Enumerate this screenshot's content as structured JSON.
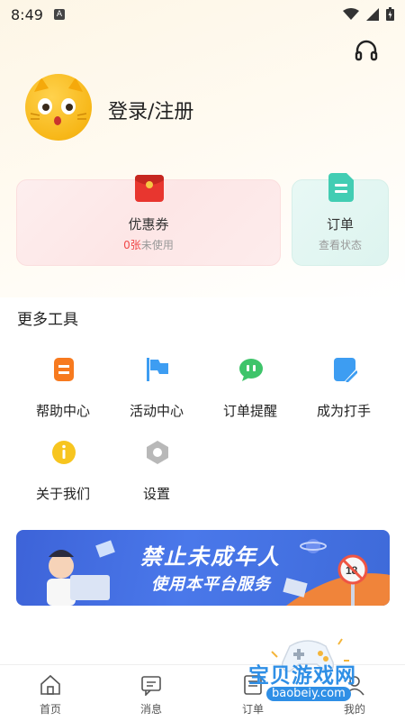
{
  "status": {
    "time": "8:49",
    "notif_letter": "A"
  },
  "header": {
    "login_text": "登录/注册"
  },
  "cards": {
    "coupon": {
      "title": "优惠券",
      "count": "0张",
      "sub": "未使用"
    },
    "order": {
      "title": "订单",
      "sub": "查看状态"
    }
  },
  "tools": {
    "section_title": "更多工具",
    "items": [
      {
        "label": "帮助中心",
        "icon": "help-icon",
        "color": "#f77a1f"
      },
      {
        "label": "活动中心",
        "icon": "flag-icon",
        "color": "#3d9df2"
      },
      {
        "label": "订单提醒",
        "icon": "chat-bubble-icon",
        "color": "#3ec46a"
      },
      {
        "label": "成为打手",
        "icon": "edit-icon",
        "color": "#3d9df2"
      },
      {
        "label": "关于我们",
        "icon": "info-icon",
        "color": "#f7c51f"
      },
      {
        "label": "设置",
        "icon": "settings-icon",
        "color": "#b8b8b8"
      }
    ]
  },
  "banner": {
    "line1": "禁止未成年人",
    "line2": "使用本平台服务",
    "badge": "18"
  },
  "tabbar": {
    "items": [
      {
        "label": "首页",
        "icon": "home-icon"
      },
      {
        "label": "消息",
        "icon": "message-icon"
      },
      {
        "label": "订单",
        "icon": "order-icon"
      },
      {
        "label": "我的",
        "icon": "profile-icon"
      }
    ]
  },
  "watermark": {
    "text": "宝贝游戏网",
    "url": "baobeiy.com"
  }
}
